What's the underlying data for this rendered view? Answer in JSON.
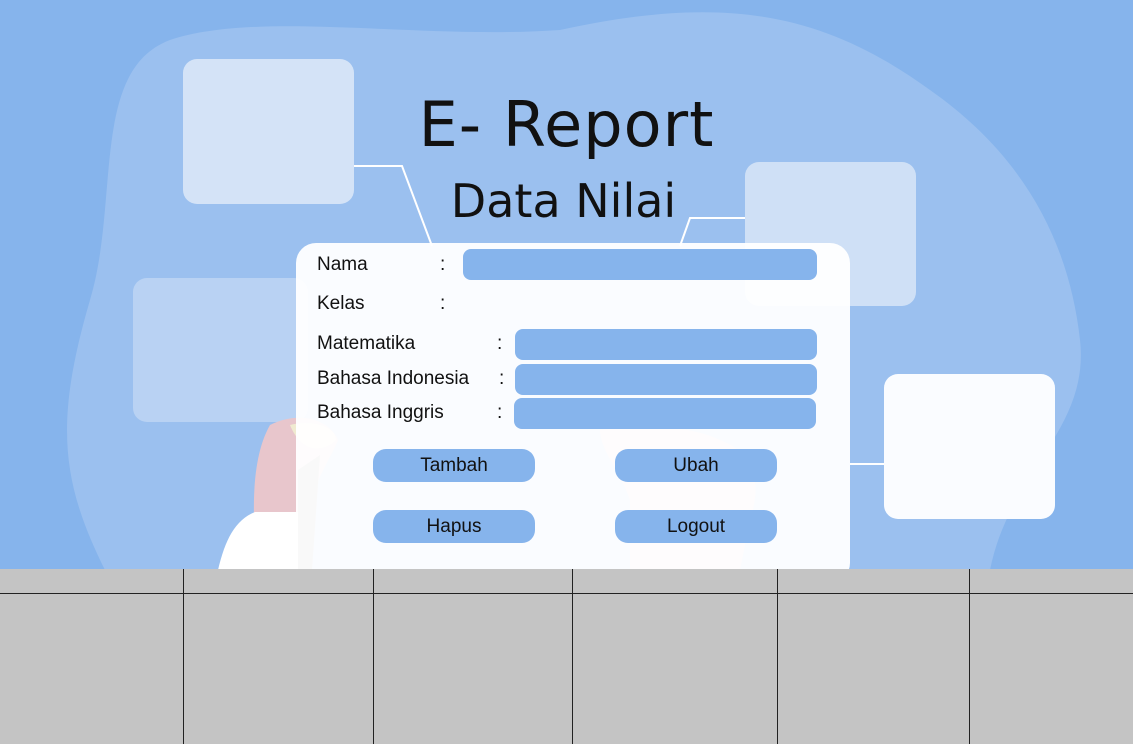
{
  "header": {
    "title": "E- Report",
    "subtitle": "Data Nilai"
  },
  "form": {
    "nama_label": "Nama",
    "kelas_label": "Kelas",
    "matematika_label": "Matematika",
    "bahasa_indonesia_label": "Bahasa Indonesia",
    "bahasa_inggris_label": "Bahasa Inggris",
    "colon": ":",
    "nama_value": "",
    "matematika_value": "",
    "bahasa_indonesia_value": "",
    "bahasa_inggris_value": ""
  },
  "buttons": {
    "tambah": "Tambah",
    "ubah": "Ubah",
    "hapus": "Hapus",
    "logout": "Logout"
  },
  "table": {
    "columns": [
      "",
      "",
      "",
      "",
      "",
      ""
    ],
    "rows": []
  },
  "colors": {
    "background": "#86b4ec",
    "field": "#86b4ec",
    "table": "#c4c4c4"
  }
}
